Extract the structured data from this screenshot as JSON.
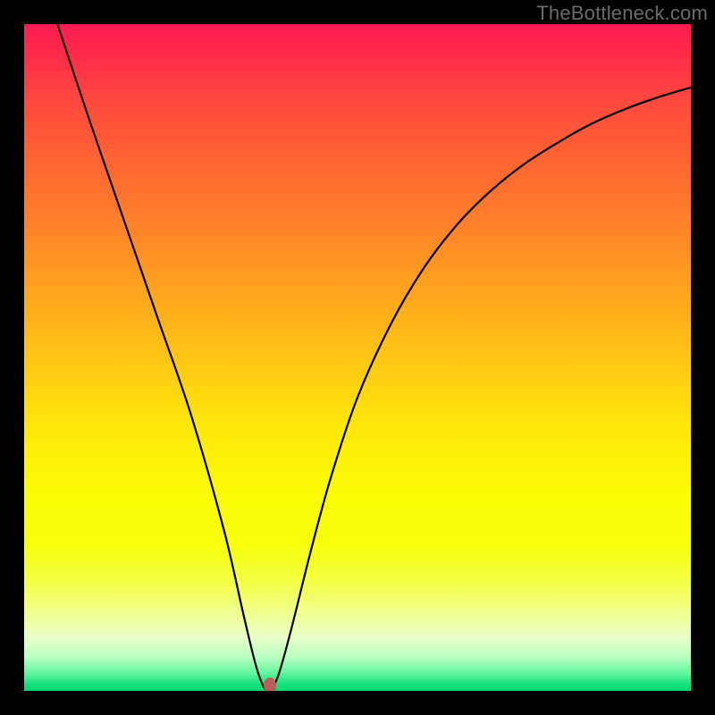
{
  "watermark": "TheBottleneck.com",
  "chart_data": {
    "type": "line",
    "title": "",
    "xlabel": "",
    "ylabel": "",
    "xlim": [
      0,
      100
    ],
    "ylim": [
      0,
      100
    ],
    "grid": false,
    "series": [
      {
        "name": "bottleneck-curve",
        "x": [
          5,
          10,
          15,
          20,
          25,
          30,
          33,
          35,
          36.5,
          38,
          40,
          43,
          46,
          50,
          55,
          60,
          65,
          70,
          75,
          80,
          85,
          90,
          95,
          100
        ],
        "values": [
          100,
          85,
          70.5,
          56,
          41.5,
          24,
          11,
          3,
          0,
          2,
          9,
          21,
          32,
          44,
          55,
          63.5,
          70,
          75,
          79,
          82.2,
          85,
          87.2,
          89,
          90.5
        ]
      }
    ],
    "marker": {
      "x": 36.8,
      "y": 0.8
    },
    "background_gradient": {
      "direction": "vertical",
      "stops": [
        {
          "pos": 0,
          "color": "#ff1a52"
        },
        {
          "pos": 0.5,
          "color": "#ffc515"
        },
        {
          "pos": 0.78,
          "color": "#f7ff0a"
        },
        {
          "pos": 1.0,
          "color": "#05d973"
        }
      ]
    },
    "frame_color": "#000000"
  }
}
